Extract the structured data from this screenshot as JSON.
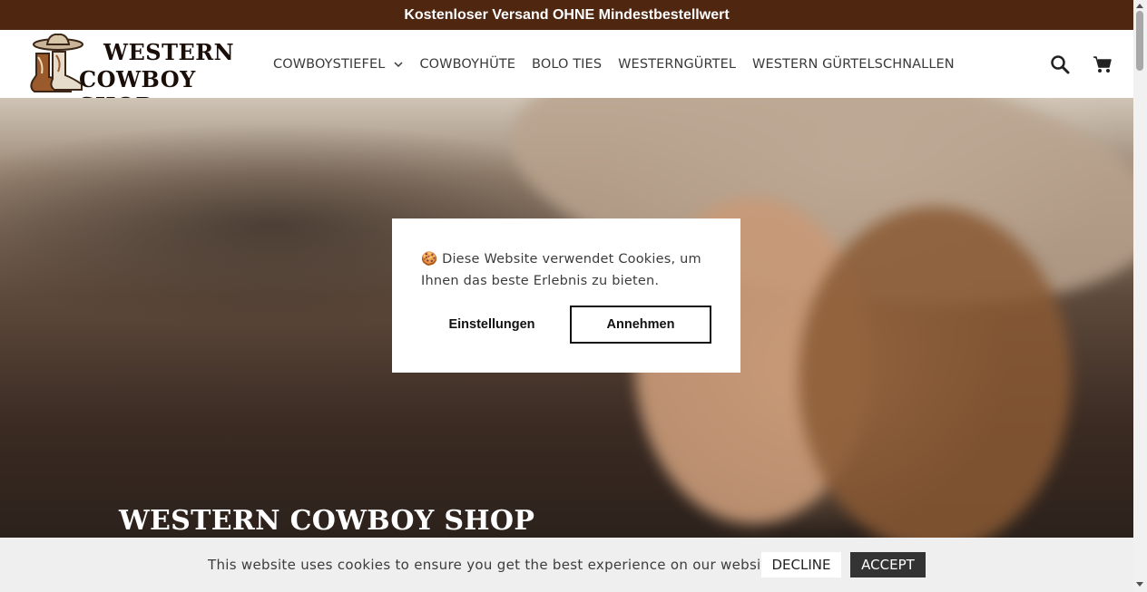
{
  "announcement": "Kostenloser Versand OHNE Mindestbestellwert",
  "logo": {
    "line1": "WESTERN",
    "line2": "COWBOY SHOP",
    "icon": "cowboy-boot-hat-logo"
  },
  "nav": {
    "items": [
      {
        "label": "COWBOYSTIEFEL",
        "has_dropdown": true
      },
      {
        "label": "COWBOYHÜTE"
      },
      {
        "label": "BOLO TIES"
      },
      {
        "label": "WESTERNGÜRTEL"
      },
      {
        "label": "WESTERN GÜRTELSCHNALLEN"
      }
    ]
  },
  "header_icons": {
    "search": "search-icon",
    "cart": "cart-icon"
  },
  "hero": {
    "title": "WESTERN COWBOY SHOP"
  },
  "cookie_modal": {
    "emoji": "🍪",
    "text": "Diese Website verwendet Cookies, um Ihnen das beste Erlebnis zu bieten.",
    "settings_label": "Einstellungen",
    "accept_label": "Annehmen"
  },
  "cookie_bar": {
    "text": "This website uses cookies to ensure you get the best experience on our website.",
    "decline_label": "DECLINE",
    "accept_label": "ACCEPT"
  },
  "colors": {
    "announcement_bg": "#4f2610",
    "cookie_bar_bg": "#efefef",
    "accept_bar_bg": "#333333"
  }
}
